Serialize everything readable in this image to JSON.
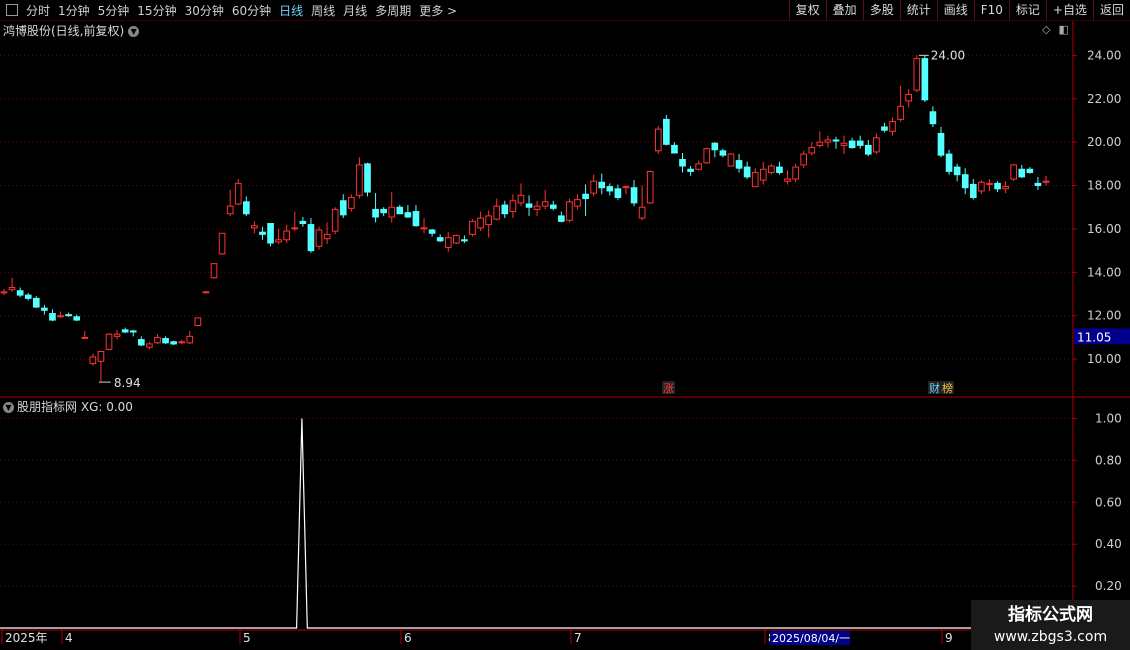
{
  "toolbar": {
    "periods": [
      "分时",
      "1分钟",
      "5分钟",
      "15分钟",
      "30分钟",
      "60分钟",
      "日线",
      "周线",
      "月线",
      "多周期",
      "更多 >"
    ],
    "active_period": "日线",
    "right_buttons": [
      "复权",
      "叠加",
      "多股",
      "统计",
      "画线",
      "F10",
      "标记",
      "+自选",
      "返回"
    ]
  },
  "main_chart": {
    "title": "鸿博股份(日线,前复权)",
    "high_label": "24.00",
    "low_label": "8.94",
    "current_price": "11.05",
    "markers": [
      {
        "text": "涨",
        "color": "#ff3b3b"
      },
      {
        "text": "财",
        "color": "#6fd1ff"
      },
      {
        "text": "榜",
        "color": "#f0c040"
      }
    ]
  },
  "indicator": {
    "title": "股朋指标网",
    "value_label": "XG: 0.00"
  },
  "watermark": {
    "line1": "指标公式网",
    "line2": "www.zbgs3.com"
  },
  "colors": {
    "up": "#ff3232",
    "down": "#54ffff",
    "grid": "#7a0000",
    "axis": "#b00000",
    "line": "#ffffff",
    "price_box": "#00008b"
  },
  "chart_data": [
    {
      "type": "candlestick",
      "title": "鸿博股份(日线,前复权)",
      "ylim": [
        8.3,
        24.8
      ],
      "y_ticks": [
        "10.00",
        "12.00",
        "14.00",
        "16.00",
        "18.00",
        "20.00",
        "22.00",
        "24.00"
      ],
      "x_ticks": [
        "2025年",
        "4",
        "5",
        "6",
        "7",
        "8",
        "9"
      ],
      "hover_date": "2025/08/04/一",
      "ohlc": [
        [
          13.05,
          13.25,
          12.95,
          13.1
        ],
        [
          13.2,
          13.75,
          13.1,
          13.3
        ],
        [
          13.15,
          13.3,
          12.85,
          12.95
        ],
        [
          12.95,
          13.05,
          12.7,
          12.8
        ],
        [
          12.8,
          12.9,
          12.35,
          12.4
        ],
        [
          12.35,
          12.5,
          12.05,
          12.25
        ],
        [
          12.1,
          12.3,
          11.75,
          11.8
        ],
        [
          11.95,
          12.2,
          11.9,
          12.0
        ],
        [
          12.05,
          12.15,
          11.95,
          12.0
        ],
        [
          11.95,
          12.05,
          11.75,
          11.8
        ],
        [
          11.0,
          11.3,
          11.0,
          11.0
        ],
        [
          9.8,
          10.25,
          9.7,
          10.1
        ],
        [
          9.9,
          10.4,
          8.94,
          10.35
        ],
        [
          10.45,
          11.2,
          10.4,
          11.15
        ],
        [
          11.05,
          11.35,
          10.9,
          11.15
        ],
        [
          11.35,
          11.45,
          11.2,
          11.25
        ],
        [
          11.3,
          11.35,
          11.05,
          11.25
        ],
        [
          10.9,
          11.05,
          10.6,
          10.65
        ],
        [
          10.55,
          10.8,
          10.45,
          10.7
        ],
        [
          10.75,
          11.15,
          10.7,
          11.0
        ],
        [
          10.95,
          11.05,
          10.7,
          10.75
        ],
        [
          10.8,
          10.85,
          10.65,
          10.7
        ],
        [
          10.75,
          10.9,
          10.7,
          10.8
        ],
        [
          10.75,
          11.3,
          10.7,
          11.05
        ],
        [
          11.55,
          11.9,
          11.5,
          11.9
        ],
        [
          13.1,
          13.15,
          13.05,
          13.1
        ],
        [
          13.75,
          14.4,
          13.7,
          14.4
        ],
        [
          14.85,
          15.8,
          14.8,
          15.8
        ],
        [
          16.7,
          17.8,
          16.6,
          17.05
        ],
        [
          17.15,
          18.3,
          17.1,
          18.1
        ],
        [
          17.25,
          17.5,
          16.6,
          16.7
        ],
        [
          16.05,
          16.35,
          15.8,
          16.15
        ],
        [
          15.85,
          16.1,
          15.5,
          15.75
        ],
        [
          16.25,
          16.25,
          15.2,
          15.35
        ],
        [
          15.4,
          16.0,
          15.3,
          15.5
        ],
        [
          15.5,
          16.2,
          15.35,
          15.9
        ],
        [
          16.05,
          16.8,
          15.9,
          16.05
        ],
        [
          16.35,
          16.55,
          16.1,
          16.25
        ],
        [
          16.2,
          16.5,
          14.9,
          15.0
        ],
        [
          15.2,
          16.1,
          15.05,
          15.95
        ],
        [
          15.55,
          16.3,
          15.3,
          15.75
        ],
        [
          15.9,
          17.0,
          15.75,
          16.9
        ],
        [
          17.3,
          17.6,
          16.5,
          16.65
        ],
        [
          16.95,
          17.6,
          16.8,
          17.45
        ],
        [
          17.55,
          19.3,
          17.4,
          18.95
        ],
        [
          19.0,
          19.05,
          17.5,
          17.7
        ],
        [
          16.9,
          17.65,
          16.3,
          16.55
        ],
        [
          16.9,
          17.0,
          16.6,
          16.75
        ],
        [
          16.55,
          17.7,
          16.3,
          17.0
        ],
        [
          17.0,
          17.1,
          16.7,
          16.7
        ],
        [
          16.75,
          17.1,
          16.5,
          16.55
        ],
        [
          16.8,
          17.1,
          16.1,
          16.15
        ],
        [
          16.05,
          16.5,
          15.8,
          16.05
        ],
        [
          15.95,
          16.0,
          15.65,
          15.8
        ],
        [
          15.6,
          15.75,
          15.4,
          15.45
        ],
        [
          15.15,
          15.85,
          14.95,
          15.6
        ],
        [
          15.35,
          15.75,
          15.3,
          15.7
        ],
        [
          15.5,
          15.7,
          15.35,
          15.45
        ],
        [
          15.75,
          16.45,
          15.65,
          16.35
        ],
        [
          16.05,
          16.8,
          15.9,
          16.5
        ],
        [
          16.2,
          16.85,
          15.6,
          16.6
        ],
        [
          16.45,
          17.4,
          16.4,
          17.05
        ],
        [
          17.1,
          17.3,
          16.5,
          16.7
        ],
        [
          16.8,
          17.6,
          16.5,
          17.3
        ],
        [
          17.2,
          18.1,
          17.05,
          17.55
        ],
        [
          17.15,
          17.55,
          16.6,
          17.0
        ],
        [
          16.9,
          17.3,
          16.6,
          17.05
        ],
        [
          17.05,
          17.8,
          16.9,
          17.25
        ],
        [
          17.1,
          17.3,
          16.85,
          16.95
        ],
        [
          16.6,
          16.8,
          16.3,
          16.35
        ],
        [
          16.4,
          17.4,
          16.3,
          17.25
        ],
        [
          17.05,
          17.6,
          16.9,
          17.35
        ],
        [
          17.6,
          18.05,
          16.6,
          17.4
        ],
        [
          17.65,
          18.5,
          17.5,
          18.2
        ],
        [
          18.15,
          18.55,
          17.6,
          17.9
        ],
        [
          17.95,
          18.1,
          17.55,
          17.75
        ],
        [
          17.85,
          18.05,
          17.35,
          17.45
        ],
        [
          17.9,
          18.0,
          17.6,
          17.95
        ],
        [
          17.9,
          18.25,
          17.05,
          17.2
        ],
        [
          16.5,
          18.0,
          16.4,
          17.0
        ],
        [
          17.2,
          18.7,
          17.15,
          18.65
        ],
        [
          19.6,
          20.75,
          19.45,
          20.6
        ],
        [
          21.05,
          21.25,
          19.85,
          19.9
        ],
        [
          19.85,
          20.0,
          19.5,
          19.5
        ],
        [
          19.2,
          19.5,
          18.6,
          18.9
        ],
        [
          18.75,
          18.9,
          18.45,
          18.65
        ],
        [
          18.75,
          19.15,
          18.7,
          19.0
        ],
        [
          19.05,
          19.75,
          19.0,
          19.7
        ],
        [
          19.95,
          20.0,
          19.3,
          19.65
        ],
        [
          19.6,
          19.7,
          19.3,
          19.4
        ],
        [
          18.9,
          19.5,
          18.9,
          19.45
        ],
        [
          19.15,
          19.45,
          18.6,
          18.8
        ],
        [
          18.85,
          19.1,
          18.3,
          18.4
        ],
        [
          17.95,
          18.8,
          17.95,
          18.6
        ],
        [
          18.25,
          19.1,
          18.05,
          18.75
        ],
        [
          18.6,
          19.0,
          18.5,
          18.9
        ],
        [
          18.85,
          19.1,
          18.5,
          18.6
        ],
        [
          18.2,
          18.7,
          18.05,
          18.3
        ],
        [
          18.3,
          19.0,
          18.15,
          18.85
        ],
        [
          18.95,
          19.6,
          18.8,
          19.45
        ],
        [
          19.5,
          20.0,
          19.4,
          19.75
        ],
        [
          19.85,
          20.5,
          19.75,
          20.0
        ],
        [
          20.0,
          20.3,
          19.75,
          20.1
        ],
        [
          20.1,
          20.25,
          19.7,
          20.05
        ],
        [
          19.85,
          20.3,
          19.45,
          19.95
        ],
        [
          20.05,
          20.2,
          19.7,
          19.75
        ],
        [
          20.05,
          20.3,
          19.7,
          19.85
        ],
        [
          19.85,
          20.1,
          19.35,
          19.45
        ],
        [
          19.55,
          20.4,
          19.45,
          20.2
        ],
        [
          20.7,
          20.9,
          20.45,
          20.55
        ],
        [
          20.5,
          21.15,
          20.3,
          20.95
        ],
        [
          21.05,
          22.6,
          20.95,
          21.65
        ],
        [
          21.9,
          22.45,
          21.6,
          22.2
        ],
        [
          22.4,
          24.0,
          22.3,
          23.85
        ],
        [
          23.85,
          24.0,
          21.85,
          21.95
        ],
        [
          21.4,
          21.65,
          20.7,
          20.85
        ],
        [
          20.4,
          20.7,
          19.3,
          19.4
        ],
        [
          19.45,
          19.65,
          18.5,
          18.65
        ],
        [
          18.85,
          19.0,
          18.2,
          18.5
        ],
        [
          18.5,
          18.8,
          17.6,
          17.9
        ],
        [
          18.05,
          18.3,
          17.35,
          17.45
        ],
        [
          17.75,
          18.25,
          17.6,
          18.15
        ],
        [
          18.05,
          18.3,
          17.75,
          18.1
        ],
        [
          18.1,
          18.2,
          17.7,
          17.85
        ],
        [
          17.85,
          18.2,
          17.65,
          17.95
        ],
        [
          18.3,
          19.0,
          18.2,
          18.95
        ],
        [
          18.75,
          18.95,
          18.35,
          18.4
        ],
        [
          18.75,
          18.85,
          18.55,
          18.6
        ],
        [
          18.1,
          18.4,
          17.8,
          18.0
        ],
        [
          18.15,
          18.45,
          18.0,
          18.2
        ]
      ]
    },
    {
      "type": "line",
      "title": "股朋指标网",
      "series": [
        {
          "name": "XG",
          "values": [
            0,
            0,
            0,
            0,
            0,
            0,
            0,
            0,
            0,
            0,
            0,
            0,
            0,
            0,
            0,
            0,
            0,
            0,
            0,
            0,
            0,
            0,
            0,
            0,
            0,
            0,
            0,
            0,
            0,
            0,
            0,
            0,
            0,
            0,
            0,
            0,
            0,
            0,
            0,
            0,
            0,
            0,
            0,
            0,
            0,
            0,
            0,
            0,
            0,
            0,
            0,
            0,
            0,
            0,
            0,
            0,
            1,
            0,
            0,
            0,
            0,
            0,
            0,
            0,
            0,
            0,
            0,
            0,
            0,
            0,
            0,
            0,
            0,
            0,
            0,
            0,
            0,
            0,
            0,
            0,
            0,
            0,
            0,
            0,
            0,
            0,
            0,
            0,
            0,
            0,
            0,
            0,
            0,
            0,
            0,
            0,
            0,
            0,
            0,
            0,
            0,
            0,
            0,
            0,
            0,
            0,
            0,
            0,
            0,
            0,
            0,
            0,
            0,
            0,
            0,
            0,
            0,
            0,
            0,
            0,
            0,
            0,
            0,
            0,
            0,
            0,
            0,
            0,
            0,
            0,
            0,
            0,
            0,
            0,
            0,
            0,
            0,
            0,
            0,
            0,
            0,
            0,
            0,
            0,
            0,
            0,
            0,
            0,
            0,
            0,
            0,
            0,
            0,
            0,
            0,
            0,
            0,
            0,
            0,
            0,
            0,
            0,
            0,
            0,
            0,
            0,
            0,
            0,
            0,
            0,
            0,
            0,
            0,
            0,
            0,
            0,
            0,
            0,
            0,
            0,
            0,
            0,
            0,
            0,
            0,
            0,
            0,
            0,
            0,
            0,
            0,
            0,
            0,
            0,
            0,
            0,
            0,
            0,
            0,
            0
          ]
        }
      ],
      "ylim": [
        0,
        1.05
      ],
      "y_ticks": [
        "0.20",
        "0.40",
        "0.60",
        "0.80",
        "1.00"
      ]
    }
  ]
}
